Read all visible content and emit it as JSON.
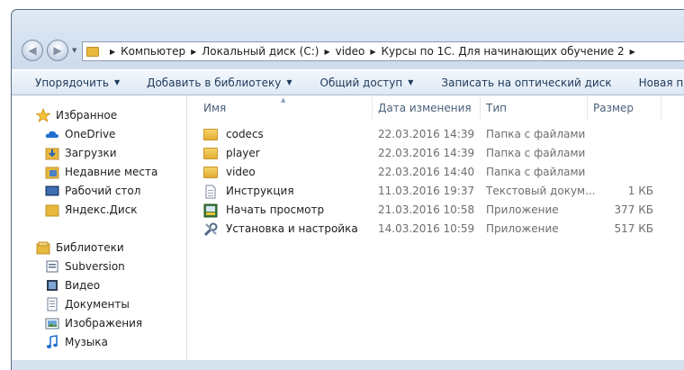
{
  "address": {
    "crumbs": [
      "Компьютер",
      "Локальный диск (C:)",
      "video",
      "Курсы по 1С. Для начинающих обучение 2"
    ]
  },
  "toolbar": {
    "organize": "Упорядочить",
    "add_library": "Добавить в библиотеку",
    "share": "Общий доступ",
    "burn": "Записать на оптический диск",
    "new_folder": "Новая папка"
  },
  "nav": {
    "favorites": {
      "label": "Избранное",
      "items": [
        "OneDrive",
        "Загрузки",
        "Недавние места",
        "Рабочий стол",
        "Яндекс.Диск"
      ]
    },
    "libraries": {
      "label": "Библиотеки",
      "items": [
        "Subversion",
        "Видео",
        "Документы",
        "Изображения",
        "Музыка"
      ]
    }
  },
  "columns": {
    "name": "Имя",
    "date": "Дата изменения",
    "type": "Тип",
    "size": "Размер"
  },
  "files": [
    {
      "name": "codecs",
      "date": "22.03.2016 14:39",
      "type": "Папка с файлами",
      "size": "",
      "icon": "folder-icon"
    },
    {
      "name": "player",
      "date": "22.03.2016 14:39",
      "type": "Папка с файлами",
      "size": "",
      "icon": "folder-icon"
    },
    {
      "name": "video",
      "date": "22.03.2016 14:40",
      "type": "Папка с файлами",
      "size": "",
      "icon": "folder-icon"
    },
    {
      "name": "Инструкция",
      "date": "11.03.2016 19:37",
      "type": "Текстовый докум...",
      "size": "1 КБ",
      "icon": "text-document-icon"
    },
    {
      "name": "Начать просмотр",
      "date": "21.03.2016 10:58",
      "type": "Приложение",
      "size": "377 КБ",
      "icon": "application-icon"
    },
    {
      "name": "Установка и настройка",
      "date": "14.03.2016 10:59",
      "type": "Приложение",
      "size": "517 КБ",
      "icon": "setup-tools-icon"
    }
  ],
  "colors": {
    "folder": "#e7b93d",
    "toolbar_text": "#1e395b",
    "header_text": "#4c607a",
    "meta_text": "#6d6d6d"
  }
}
